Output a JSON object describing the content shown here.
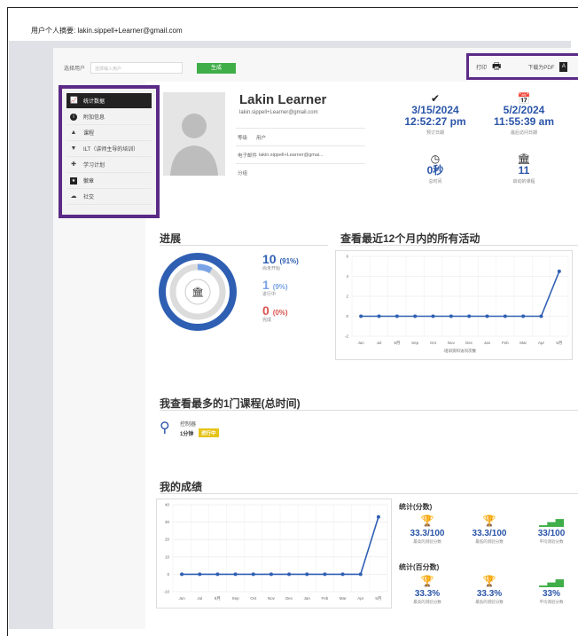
{
  "header": {
    "title": "用户个人摘要: lakin.sippell+Learner@gmail.com"
  },
  "toolbar": {
    "select_label": "选择用户",
    "select_placeholder": "选择输入用户",
    "generate_label": "生成"
  },
  "actions": {
    "print_label": "打印",
    "download_label": "下载为PDF"
  },
  "sidebar": {
    "items": [
      {
        "label": "统计数据",
        "icon": "chart-icon"
      },
      {
        "label": "附加信息",
        "icon": "info-icon"
      },
      {
        "label": "课程",
        "icon": "courses-icon"
      },
      {
        "label": "ILT（讲师主导的培训）",
        "icon": "ilt-icon"
      },
      {
        "label": "学习计划",
        "icon": "learning-plan-icon"
      },
      {
        "label": "徽章",
        "icon": "badge-icon"
      },
      {
        "label": "社交",
        "icon": "social-icon"
      }
    ]
  },
  "profile": {
    "name": "Lakin Learner",
    "email": "lakin.sippell+Learner@gmail.com",
    "level_label": "等级",
    "level_value": "用户",
    "email_label": "电子邮件",
    "email_value": "lakin.sippell+Learner@gmai...",
    "group_label": "分组"
  },
  "stats": {
    "created_date": "3/15/2024",
    "created_time": "12:52:27 pm",
    "created_label": "预订日期",
    "last_date": "5/2/2024",
    "last_time": "11:55:39 am",
    "last_label": "最后访问日期",
    "time_value": "0秒",
    "time_label": "总时间",
    "courses_value": "11",
    "courses_label": "启动的课程"
  },
  "progress": {
    "title": "进展",
    "not_started_count": "10",
    "not_started_pct": "(91%)",
    "not_started_label": "尚未开始",
    "in_progress_count": "1",
    "in_progress_pct": "(9%)",
    "in_progress_label": "进行中",
    "completed_count": "0",
    "completed_pct": "(0%)",
    "completed_label": "完成",
    "colors": {
      "not_started": "#2f5fb3",
      "in_progress": "#7aa3e6",
      "completed": "#d9534f"
    }
  },
  "activity": {
    "title": "查看最近12个月内的所有活动",
    "xlabel": "培训资料访问次数"
  },
  "top_courses": {
    "title": "我查看最多的1门课程(总时间)",
    "course_name": "控制器",
    "course_time": "1分钟",
    "course_status": "进行中"
  },
  "scores": {
    "title": "我的成绩",
    "points_header": "统计(分数)",
    "pct_header": "统计(百分数)",
    "p_highest": "33.3/100",
    "p_highest_label": "最高的测验分数",
    "p_lowest": "33.3/100",
    "p_lowest_label": "最低的测验分数",
    "p_avg": "33/100",
    "p_avg_label": "平均测验分数",
    "c_highest": "33.3%",
    "c_highest_label": "最高的测验分数",
    "c_lowest": "33.3%",
    "c_lowest_label": "最低的测验分数",
    "c_avg": "33%",
    "c_avg_label": "平均测验分数"
  },
  "chart_data": [
    {
      "type": "line",
      "x": [
        "Jun",
        "Jul",
        "8月",
        "Sep",
        "Oct",
        "Nov",
        "Dec",
        "Jan",
        "Feb",
        "Mar",
        "Apr",
        "5月"
      ],
      "y_ticks": [
        "-2",
        "0",
        "2",
        "4",
        "6"
      ],
      "series": [
        {
          "values": [
            0,
            0,
            0,
            0,
            0,
            0,
            0,
            0,
            0,
            0,
            0,
            4.5
          ]
        }
      ],
      "xlabel": "培训资料访问次数",
      "ylim": [
        -2,
        6
      ],
      "color": "#2f5fb3"
    },
    {
      "type": "line",
      "x": [
        "Jun",
        "Jul",
        "8月",
        "Sep",
        "Oct",
        "Nov",
        "Dec",
        "Jan",
        "Feb",
        "Mar",
        "Apr",
        "5月"
      ],
      "y_ticks": [
        "-10",
        "0",
        "10",
        "20",
        "30",
        "40"
      ],
      "series": [
        {
          "values": [
            0,
            0,
            0,
            0,
            0,
            0,
            0,
            0,
            0,
            0,
            0,
            33
          ]
        }
      ],
      "ylim": [
        -10,
        40
      ],
      "color": "#2f5fb3"
    }
  ]
}
